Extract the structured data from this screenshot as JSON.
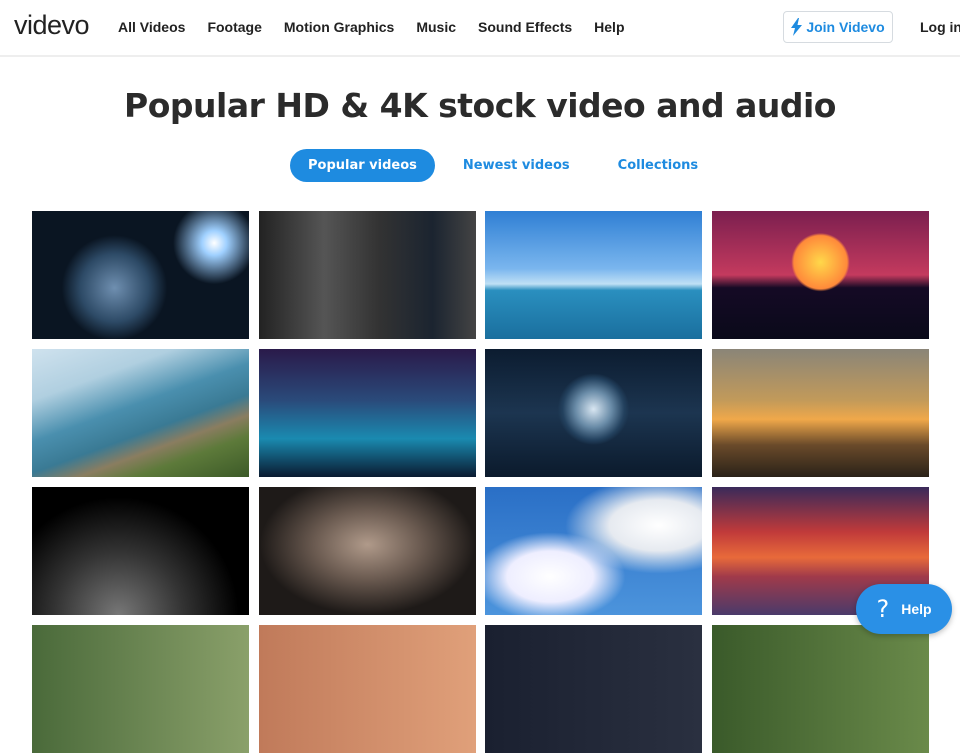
{
  "brand": {
    "logo": "videvo"
  },
  "nav": {
    "items": [
      "All Videos",
      "Footage",
      "Motion Graphics",
      "Music",
      "Sound Effects",
      "Help"
    ],
    "join": "Join Videvo",
    "login": "Log in"
  },
  "page": {
    "title": "Popular HD & 4K stock video and audio"
  },
  "tabs": {
    "popular": "Popular videos",
    "newest": "Newest videos",
    "collections": "Collections"
  },
  "thumbnails": [
    {
      "bg": "radial-gradient(circle at 84% 25%,#fff 0,#9fd0ff 6%,transparent 20%),radial-gradient(circle at 38% 60%,#6f8fb0 0,#2d4a66 22%,#0a1522 34%),#07101a"
    },
    {
      "bg": "linear-gradient(90deg,#222 0,#555 30%,#333 55%,#1b2430 80%,#444 100%)"
    },
    {
      "bg": "linear-gradient(180deg,#2f7fd4 0,#7ab6ee 45%,#bfe0f5 57%,#2a8fbf 62%,#1a6f9e 100%)"
    },
    {
      "bg": "radial-gradient(circle at 50% 40%,#ffd84a 0,#ff8a3a 20%,transparent 22%),linear-gradient(180deg,#7b1f4f 0,#c43a5e 50%,#150a25 60%,#0a0a1a 100%)"
    },
    {
      "bg": "linear-gradient(160deg,#cfe2ee 0,#b0cfe0 25%,#4a8fae 45%,#3a7a94 60%,#8a7d60 70%,#5d7a3a 80%,#3c5a28 100%)"
    },
    {
      "bg": "linear-gradient(180deg,#2a1a4a 0,#2a4a7a 40%,#1a8ab0 70%,#0a1a30 100%)"
    },
    {
      "bg": "radial-gradient(circle at 50% 47%,#d8e6f2 0,#6a8ca8 14%,#23415e 24%,transparent 28%),linear-gradient(180deg,#0c1c30,#1c3550 50%,#0b1a2c)"
    },
    {
      "bg": "linear-gradient(180deg,#8a8578 0,#c29a5a 40%,#f0a84a 55%,#6a4a2a 75%,#2a2218 100%)"
    },
    {
      "bg": "radial-gradient(ellipse at 40% 100%,#777 0,#333 35%,#000 65%),#000"
    },
    {
      "bg": "radial-gradient(ellipse at 50% 45%,#b09a8a 0,#6a5a50 35%,#1e1a18 70%),#111"
    },
    {
      "bg": "radial-gradient(ellipse at 30% 70%,#fff 0,#eef 20%,transparent 35%),radial-gradient(ellipse at 80% 30%,#fff 0,#e6eaf0 20%,transparent 38%),linear-gradient(180deg,#2a6fc6,#4c94dc)"
    },
    {
      "bg": "linear-gradient(180deg,#3a2a5a 0,#c03a3a 35%,#e86a3a 55%,#a03a4a 70%,#4a3a6a 100%)"
    },
    {
      "bg": "linear-gradient(90deg,#4a6a3a,#8aa06a)"
    },
    {
      "bg": "linear-gradient(90deg,#c07a5a,#e0a07a)"
    },
    {
      "bg": "linear-gradient(90deg,#1a2030,#2a3040)"
    },
    {
      "bg": "linear-gradient(90deg,#3a5a2a,#6a8a4a)"
    }
  ],
  "help_widget": {
    "label": "Help",
    "icon": "?"
  }
}
